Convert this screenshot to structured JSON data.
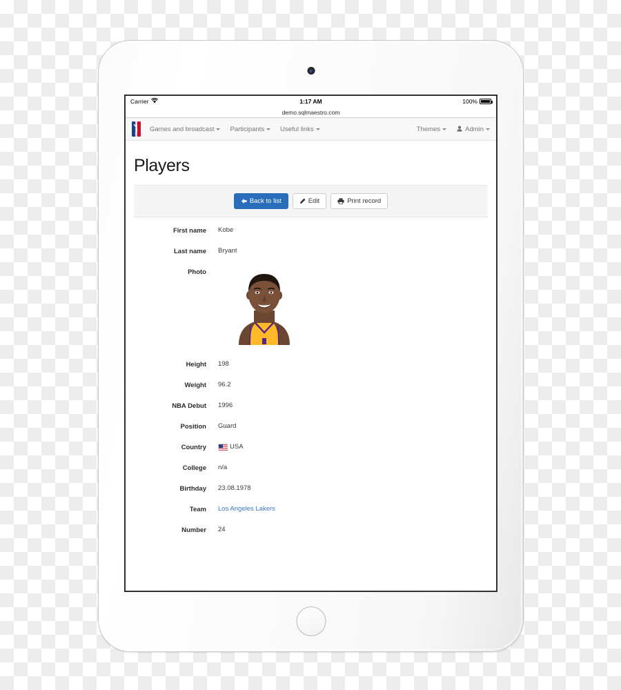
{
  "device": {
    "type": "tablet",
    "camera_icon": "front-camera",
    "home_button_icon": "home-button"
  },
  "status_bar": {
    "carrier": "Carrier",
    "wifi_icon": "wifi-icon",
    "time": "1:17 AM",
    "battery_percent": "100%",
    "battery_icon": "battery-full-icon"
  },
  "browser": {
    "url": "demo.sqlmaestro.com"
  },
  "navbar": {
    "brand_icon": "nba-logo-icon",
    "items": [
      {
        "label": "Games and broadcast",
        "caret": true
      },
      {
        "label": "Participants",
        "caret": true
      },
      {
        "label": "Useful links",
        "caret": true
      }
    ],
    "right_items": [
      {
        "label": "Themes",
        "caret": true,
        "icon": null
      },
      {
        "label": "Admin",
        "caret": true,
        "icon": "user-icon"
      }
    ]
  },
  "page": {
    "title": "Players"
  },
  "toolbar": {
    "back_label": "Back to list",
    "back_icon": "arrow-left-icon",
    "edit_label": "Edit",
    "edit_icon": "pencil-icon",
    "print_label": "Print record",
    "print_icon": "printer-icon"
  },
  "record": {
    "fields": [
      {
        "label": "First name",
        "value": "Kobe",
        "type": "text"
      },
      {
        "label": "Last name",
        "value": "Bryant",
        "type": "text"
      },
      {
        "label": "Photo",
        "value": "",
        "type": "photo"
      },
      {
        "label": "Height",
        "value": "198",
        "type": "text"
      },
      {
        "label": "Weight",
        "value": "96.2",
        "type": "text"
      },
      {
        "label": "NBA Debut",
        "value": "1996",
        "type": "text"
      },
      {
        "label": "Position",
        "value": "Guard",
        "type": "text"
      },
      {
        "label": "Country",
        "value": "USA",
        "type": "flag"
      },
      {
        "label": "College",
        "value": "n/a",
        "type": "text"
      },
      {
        "label": "Birthday",
        "value": "23.08.1978",
        "type": "text"
      },
      {
        "label": "Team",
        "value": "Los Angeles Lakers",
        "type": "link"
      },
      {
        "label": "Number",
        "value": "24",
        "type": "text"
      }
    ]
  },
  "colors": {
    "primary_button": "#2a6ebb",
    "link": "#3978c4",
    "toolbar_bg": "#f5f5f5",
    "navbar_bg": "#f8f8f8"
  }
}
